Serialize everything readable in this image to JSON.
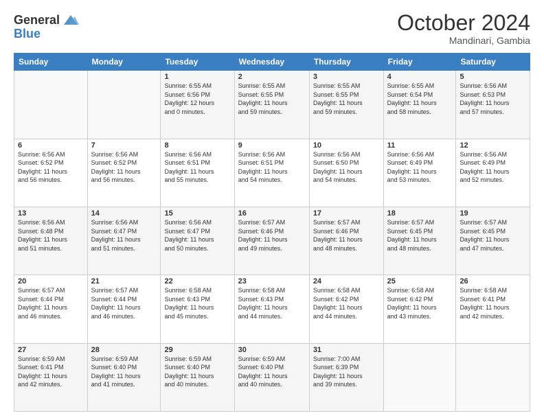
{
  "header": {
    "logo_general": "General",
    "logo_blue": "Blue",
    "month": "October 2024",
    "location": "Mandinari, Gambia"
  },
  "days_of_week": [
    "Sunday",
    "Monday",
    "Tuesday",
    "Wednesday",
    "Thursday",
    "Friday",
    "Saturday"
  ],
  "weeks": [
    [
      {
        "day": "",
        "info": ""
      },
      {
        "day": "",
        "info": ""
      },
      {
        "day": "1",
        "info": "Sunrise: 6:55 AM\nSunset: 6:56 PM\nDaylight: 12 hours\nand 0 minutes."
      },
      {
        "day": "2",
        "info": "Sunrise: 6:55 AM\nSunset: 6:55 PM\nDaylight: 11 hours\nand 59 minutes."
      },
      {
        "day": "3",
        "info": "Sunrise: 6:55 AM\nSunset: 6:55 PM\nDaylight: 11 hours\nand 59 minutes."
      },
      {
        "day": "4",
        "info": "Sunrise: 6:55 AM\nSunset: 6:54 PM\nDaylight: 11 hours\nand 58 minutes."
      },
      {
        "day": "5",
        "info": "Sunrise: 6:56 AM\nSunset: 6:53 PM\nDaylight: 11 hours\nand 57 minutes."
      }
    ],
    [
      {
        "day": "6",
        "info": "Sunrise: 6:56 AM\nSunset: 6:52 PM\nDaylight: 11 hours\nand 56 minutes."
      },
      {
        "day": "7",
        "info": "Sunrise: 6:56 AM\nSunset: 6:52 PM\nDaylight: 11 hours\nand 56 minutes."
      },
      {
        "day": "8",
        "info": "Sunrise: 6:56 AM\nSunset: 6:51 PM\nDaylight: 11 hours\nand 55 minutes."
      },
      {
        "day": "9",
        "info": "Sunrise: 6:56 AM\nSunset: 6:51 PM\nDaylight: 11 hours\nand 54 minutes."
      },
      {
        "day": "10",
        "info": "Sunrise: 6:56 AM\nSunset: 6:50 PM\nDaylight: 11 hours\nand 54 minutes."
      },
      {
        "day": "11",
        "info": "Sunrise: 6:56 AM\nSunset: 6:49 PM\nDaylight: 11 hours\nand 53 minutes."
      },
      {
        "day": "12",
        "info": "Sunrise: 6:56 AM\nSunset: 6:49 PM\nDaylight: 11 hours\nand 52 minutes."
      }
    ],
    [
      {
        "day": "13",
        "info": "Sunrise: 6:56 AM\nSunset: 6:48 PM\nDaylight: 11 hours\nand 51 minutes."
      },
      {
        "day": "14",
        "info": "Sunrise: 6:56 AM\nSunset: 6:47 PM\nDaylight: 11 hours\nand 51 minutes."
      },
      {
        "day": "15",
        "info": "Sunrise: 6:56 AM\nSunset: 6:47 PM\nDaylight: 11 hours\nand 50 minutes."
      },
      {
        "day": "16",
        "info": "Sunrise: 6:57 AM\nSunset: 6:46 PM\nDaylight: 11 hours\nand 49 minutes."
      },
      {
        "day": "17",
        "info": "Sunrise: 6:57 AM\nSunset: 6:46 PM\nDaylight: 11 hours\nand 48 minutes."
      },
      {
        "day": "18",
        "info": "Sunrise: 6:57 AM\nSunset: 6:45 PM\nDaylight: 11 hours\nand 48 minutes."
      },
      {
        "day": "19",
        "info": "Sunrise: 6:57 AM\nSunset: 6:45 PM\nDaylight: 11 hours\nand 47 minutes."
      }
    ],
    [
      {
        "day": "20",
        "info": "Sunrise: 6:57 AM\nSunset: 6:44 PM\nDaylight: 11 hours\nand 46 minutes."
      },
      {
        "day": "21",
        "info": "Sunrise: 6:57 AM\nSunset: 6:44 PM\nDaylight: 11 hours\nand 46 minutes."
      },
      {
        "day": "22",
        "info": "Sunrise: 6:58 AM\nSunset: 6:43 PM\nDaylight: 11 hours\nand 45 minutes."
      },
      {
        "day": "23",
        "info": "Sunrise: 6:58 AM\nSunset: 6:43 PM\nDaylight: 11 hours\nand 44 minutes."
      },
      {
        "day": "24",
        "info": "Sunrise: 6:58 AM\nSunset: 6:42 PM\nDaylight: 11 hours\nand 44 minutes."
      },
      {
        "day": "25",
        "info": "Sunrise: 6:58 AM\nSunset: 6:42 PM\nDaylight: 11 hours\nand 43 minutes."
      },
      {
        "day": "26",
        "info": "Sunrise: 6:58 AM\nSunset: 6:41 PM\nDaylight: 11 hours\nand 42 minutes."
      }
    ],
    [
      {
        "day": "27",
        "info": "Sunrise: 6:59 AM\nSunset: 6:41 PM\nDaylight: 11 hours\nand 42 minutes."
      },
      {
        "day": "28",
        "info": "Sunrise: 6:59 AM\nSunset: 6:40 PM\nDaylight: 11 hours\nand 41 minutes."
      },
      {
        "day": "29",
        "info": "Sunrise: 6:59 AM\nSunset: 6:40 PM\nDaylight: 11 hours\nand 40 minutes."
      },
      {
        "day": "30",
        "info": "Sunrise: 6:59 AM\nSunset: 6:40 PM\nDaylight: 11 hours\nand 40 minutes."
      },
      {
        "day": "31",
        "info": "Sunrise: 7:00 AM\nSunset: 6:39 PM\nDaylight: 11 hours\nand 39 minutes."
      },
      {
        "day": "",
        "info": ""
      },
      {
        "day": "",
        "info": ""
      }
    ]
  ]
}
